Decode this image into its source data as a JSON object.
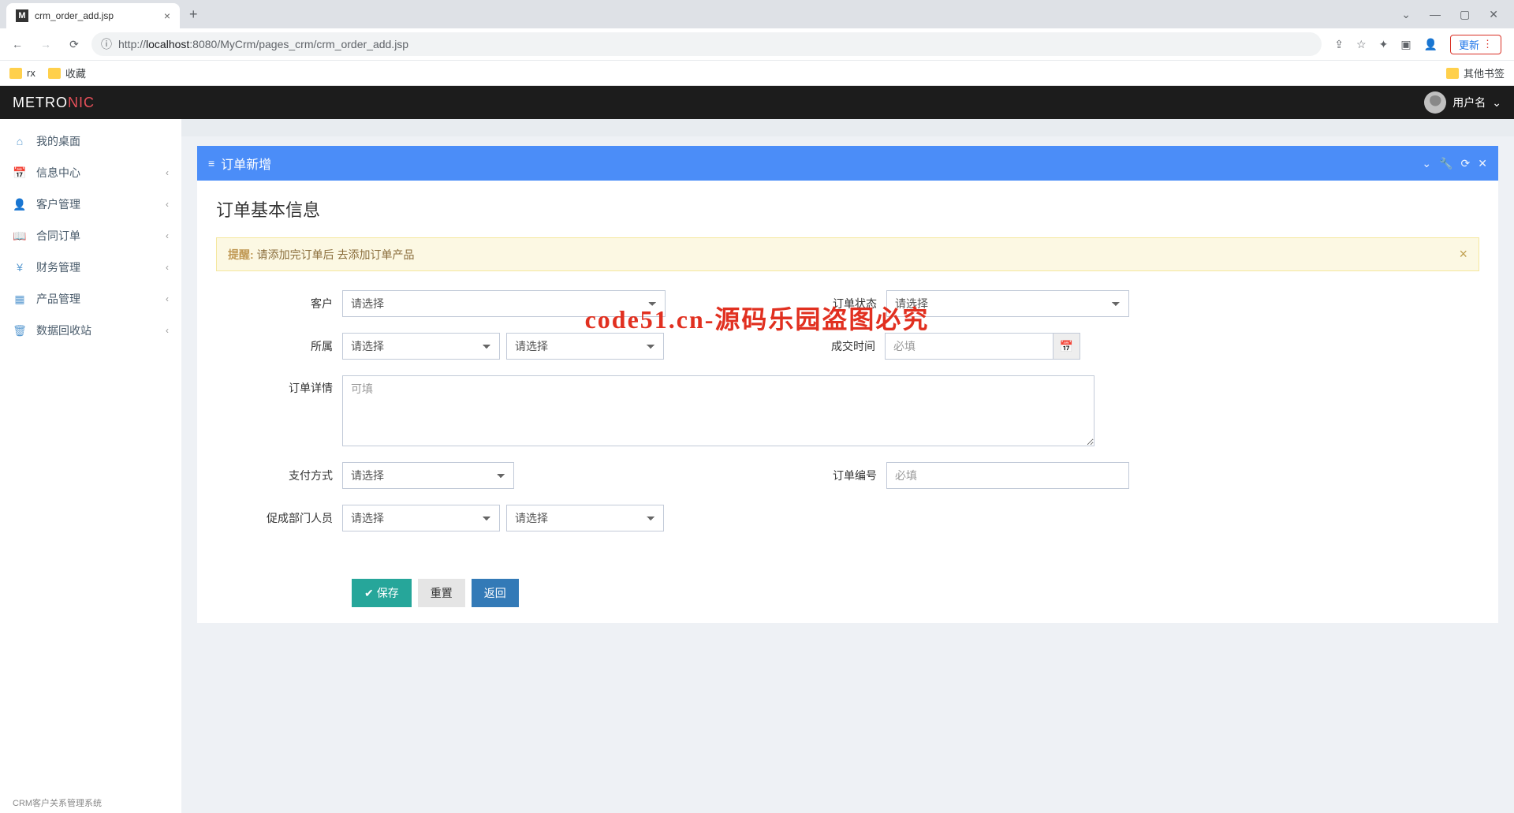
{
  "browser": {
    "tab_title": "crm_order_add.jsp",
    "tab_favicon": "M",
    "url_prefix": "http://",
    "url_host": "localhost",
    "url_port": ":8080",
    "url_path": "/MyCrm/pages_crm/crm_order_add.jsp",
    "update_label": "更新",
    "bookmarks": {
      "rx": "rx",
      "fav": "收藏",
      "other": "其他书签"
    }
  },
  "header": {
    "logo_a": "METRO",
    "logo_b": "NIC",
    "username": "用户名"
  },
  "sidebar": {
    "items": [
      {
        "icon": "⌂",
        "label": "我的桌面",
        "has_arrow": false
      },
      {
        "icon": "📅",
        "label": "信息中心",
        "has_arrow": true
      },
      {
        "icon": "👤",
        "label": "客户管理",
        "has_arrow": true
      },
      {
        "icon": "📖",
        "label": "合同订单",
        "has_arrow": true
      },
      {
        "icon": "¥",
        "label": "财务管理",
        "has_arrow": true
      },
      {
        "icon": "▦",
        "label": "产品管理",
        "has_arrow": true
      },
      {
        "icon": "🗑",
        "label": "数据回收站",
        "has_arrow": true
      }
    ]
  },
  "panel": {
    "title": "订单新增",
    "section_title": "订单基本信息",
    "alert_label": "提醒:",
    "alert_text": "请添加完订单后 去添加订单产品"
  },
  "form": {
    "customer_label": "客户",
    "customer_placeholder": "请选择",
    "order_status_label": "订单状态",
    "order_status_placeholder": "请选择",
    "owner_label": "所属",
    "owner_placeholder": "请选择",
    "owner2_placeholder": "请选择",
    "deal_time_label": "成交时间",
    "deal_time_placeholder": "必填",
    "detail_label": "订单详情",
    "detail_placeholder": "可填",
    "payment_label": "支付方式",
    "payment_placeholder": "请选择",
    "order_no_label": "订单编号",
    "order_no_placeholder": "必填",
    "dept_staff_label": "促成部门人员",
    "dept_placeholder": "请选择",
    "staff_placeholder": "请选择"
  },
  "actions": {
    "save": "保存",
    "reset": "重置",
    "back": "返回"
  },
  "watermark": "code51.cn-源码乐园盗图必究",
  "footer_hint": "CRM客户关系管理系统"
}
